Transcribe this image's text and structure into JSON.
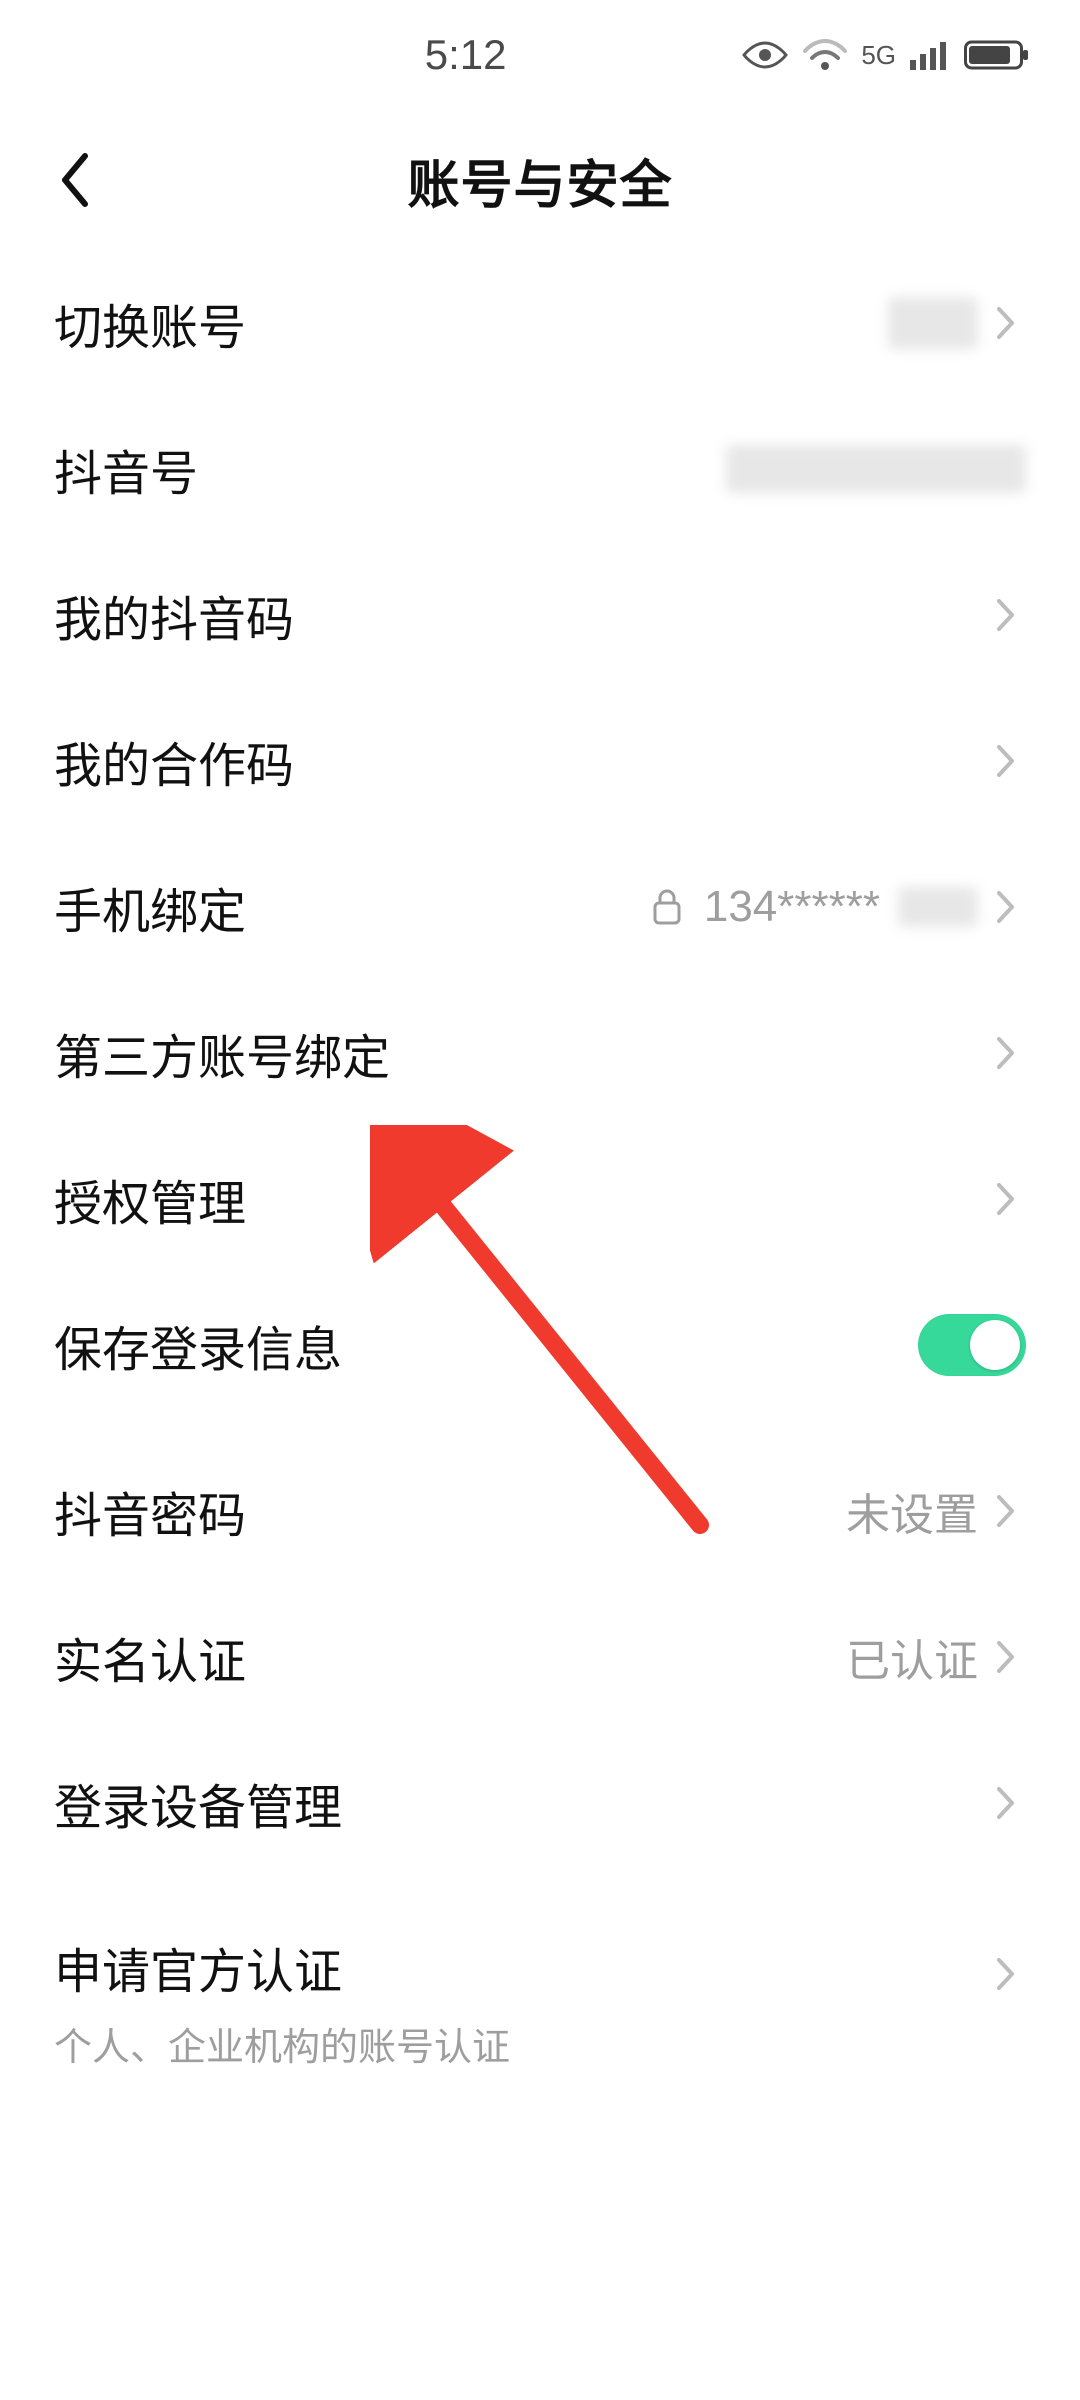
{
  "status": {
    "time": "5:12",
    "network": "5G"
  },
  "header": {
    "title": "账号与安全"
  },
  "rows": {
    "switch_account": {
      "label": "切换账号"
    },
    "douyin_id": {
      "label": "抖音号"
    },
    "my_qr": {
      "label": "我的抖音码"
    },
    "coop_code": {
      "label": "我的合作码"
    },
    "phone_bind": {
      "label": "手机绑定",
      "value": "134******"
    },
    "third_party": {
      "label": "第三方账号绑定"
    },
    "auth_mgmt": {
      "label": "授权管理"
    },
    "save_login": {
      "label": "保存登录信息",
      "toggle_on": true
    },
    "password": {
      "label": "抖音密码",
      "value": "未设置"
    },
    "verified": {
      "label": "实名认证",
      "value": "已认证"
    },
    "devices": {
      "label": "登录设备管理"
    },
    "official_cert": {
      "label": "申请官方认证",
      "sub": "个人、企业机构的账号认证"
    }
  }
}
